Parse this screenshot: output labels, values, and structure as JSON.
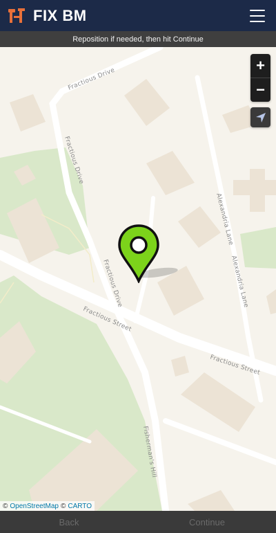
{
  "header": {
    "brand": "FIX BM",
    "menu_icon": "hamburger-menu-icon"
  },
  "instruction": "Reposition if needed, then hit Continue",
  "map": {
    "road_labels": {
      "fractious_drive_top": "Fractious Drive",
      "fractious_drive_left": "Fractious Drive",
      "fractious_drive_mid": "Fractious Drive",
      "fractious_street_left": "Fractious Street",
      "fractious_street_right": "Fractious Street",
      "alexandria_lane_a": "Alexandria Lane",
      "alexandria_lane_b": "Alexandria Lane",
      "fishermans_hill": "Fisherman's Hill"
    },
    "controls": {
      "zoom_in": "+",
      "zoom_out": "−"
    },
    "pin_color": "#7cd31b"
  },
  "attribution": {
    "osm_symbol": "©",
    "osm": "OpenStreetMap",
    "carto_symbol": "©",
    "carto": "CARTO"
  },
  "footer": {
    "back": "Back",
    "continue": "Continue"
  }
}
